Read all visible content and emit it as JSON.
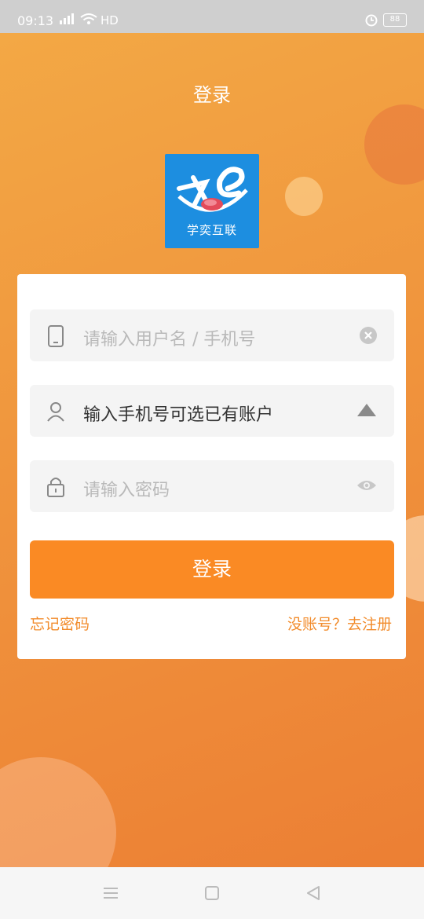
{
  "status_bar": {
    "time": "09:13",
    "network": "HD",
    "battery": "88"
  },
  "header": {
    "title": "登录"
  },
  "logo": {
    "caption": "学奕互联"
  },
  "form": {
    "username": {
      "placeholder": "请输入用户名 / 手机号"
    },
    "account": {
      "value": "输入手机号可选已有账户"
    },
    "password": {
      "placeholder": "请输入密码"
    },
    "login_label": "登录",
    "forgot_label": "忘记密码",
    "register_label": "没账号？去注册"
  },
  "colors": {
    "accent": "#fa8a24",
    "link": "#f28c2c",
    "logo_bg": "#1d8ee0"
  },
  "icons": [
    "phone-icon",
    "clear-icon",
    "user-icon",
    "dropdown-arrow-icon",
    "lock-icon",
    "eye-icon",
    "menu-icon",
    "home-icon",
    "back-icon"
  ]
}
